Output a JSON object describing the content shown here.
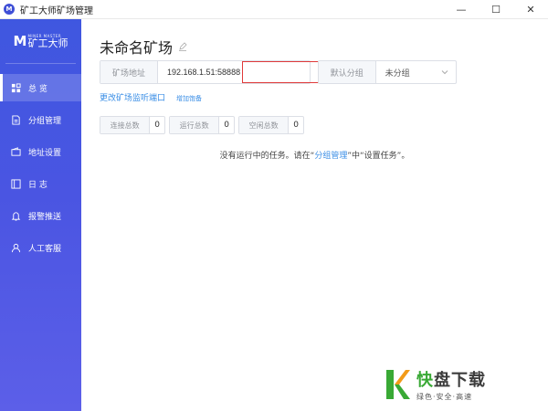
{
  "window": {
    "title": "矿工大师矿场管理",
    "icon_letter": "M",
    "controls": {
      "minimize": "—",
      "maximize": "☐",
      "close": "✕"
    }
  },
  "sidebar": {
    "logo": {
      "mark": "M",
      "sub": "MINER MASTER",
      "main": "矿工大师"
    },
    "items": [
      {
        "label": "总 览",
        "icon": "dashboard-icon",
        "active": true
      },
      {
        "label": "分组管理",
        "icon": "document-icon",
        "active": false
      },
      {
        "label": "地址设置",
        "icon": "wallet-icon",
        "active": false
      },
      {
        "label": "日 志",
        "icon": "log-icon",
        "active": false
      },
      {
        "label": "报警推送",
        "icon": "bell-icon",
        "active": false
      },
      {
        "label": "人工客服",
        "icon": "user-icon",
        "active": false
      }
    ]
  },
  "main": {
    "title": "未命名矿场",
    "address": {
      "label": "矿场地址",
      "value": "192.168.1.51:58888"
    },
    "group": {
      "label": "默认分组",
      "value": "未分组"
    },
    "links": {
      "change_port": "更改矿场监听端口",
      "add_backup": "增加饱备"
    },
    "stats": [
      {
        "label": "连接总数",
        "value": "0"
      },
      {
        "label": "运行总数",
        "value": "0"
      },
      {
        "label": "空闲总数",
        "value": "0"
      }
    ],
    "message": {
      "before": "没有运行中的任务。请在“",
      "link": "分组管理",
      "after": "”中“设置任务”。"
    }
  },
  "watermark": {
    "main_a": "快",
    "main_b": "盘下载",
    "sub": "绿色·安全·高速"
  },
  "colors": {
    "sidebar": "#4a55e2",
    "link": "#3a8ee6",
    "highlight": "#e03a3a",
    "watermark_green": "#39a935",
    "watermark_orange": "#f29b19"
  }
}
